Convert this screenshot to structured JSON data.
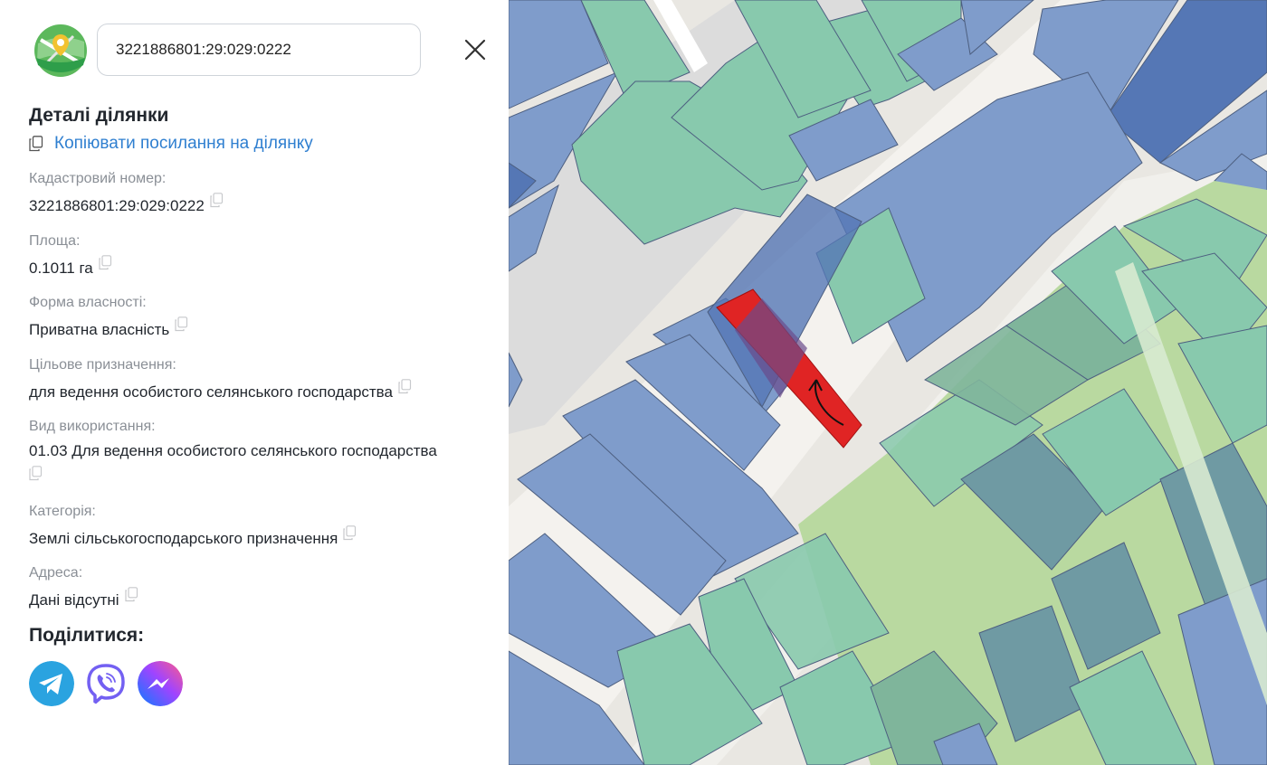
{
  "search": {
    "value": "3221886801:29:029:0222"
  },
  "details": {
    "title": "Деталі ділянки",
    "copy_link": "Копіювати посилання на ділянку",
    "fields": [
      {
        "label": "Кадастровий номер:",
        "value": "3221886801:29:029:0222"
      },
      {
        "label": "Площа:",
        "value": "0.1011 га"
      },
      {
        "label": "Форма власності:",
        "value": "Приватна власність"
      },
      {
        "label": "Цільове призначення:",
        "value": "для ведення особистого селянського господарства"
      },
      {
        "label": "Вид використання:",
        "value": "01.03 Для ведення особистого селянського господарства"
      },
      {
        "label": "Категорія:",
        "value": "Землі сільськогосподарського призначення"
      },
      {
        "label": "Адреса:",
        "value": "Дані відсутні"
      }
    ]
  },
  "share": {
    "title": "Поділитися:",
    "buttons": [
      {
        "name": "telegram",
        "color": "#2aa3e0"
      },
      {
        "name": "viber",
        "color": "#7360f2"
      },
      {
        "name": "messenger",
        "color": "#a044ff"
      }
    ]
  },
  "map": {
    "colors": {
      "background": "#e9e7e2",
      "road": "#f4f2ee",
      "parcel_blue": "#7f9ccb",
      "parcel_green": "#88c9ad",
      "park": "#b9d9a0",
      "selected": "#e02424"
    }
  }
}
